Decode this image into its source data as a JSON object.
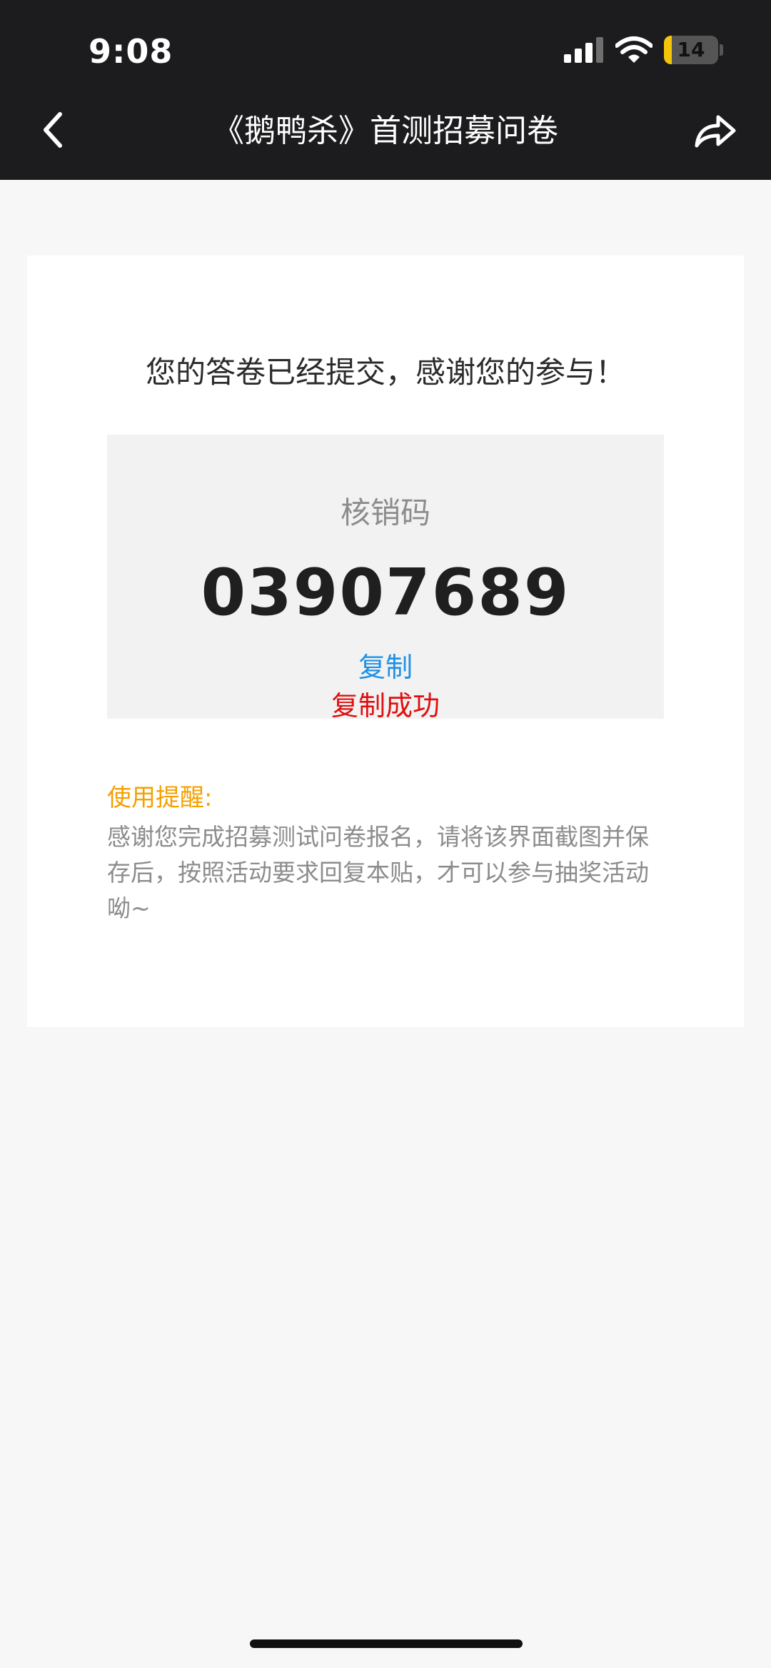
{
  "status_bar": {
    "time": "9:08",
    "battery_level": "14",
    "battery_fraction": 0.14,
    "battery_color": "#f4c60a"
  },
  "nav": {
    "title": "《鹅鸭杀》首测招募问卷",
    "back_icon": "chevron-left-icon",
    "share_icon": "share-arrow-icon"
  },
  "result": {
    "message": "您的答卷已经提交，感谢您的参与！",
    "code_label": "核销码",
    "code_value": "03907689",
    "copy_label": "复制",
    "copy_success": "复制成功"
  },
  "tips": {
    "title": "使用提醒:",
    "body": "感谢您完成招募测试问卷报名，请将该界面截图并保存后，按照活动要求回复本贴，才可以参与抽奖活动呦~"
  },
  "colors": {
    "header_bg": "#1c1c1e",
    "page_bg": "#f7f7f7",
    "link": "#1e90e6",
    "success": "#e01010",
    "tip_title": "#f5a000"
  }
}
